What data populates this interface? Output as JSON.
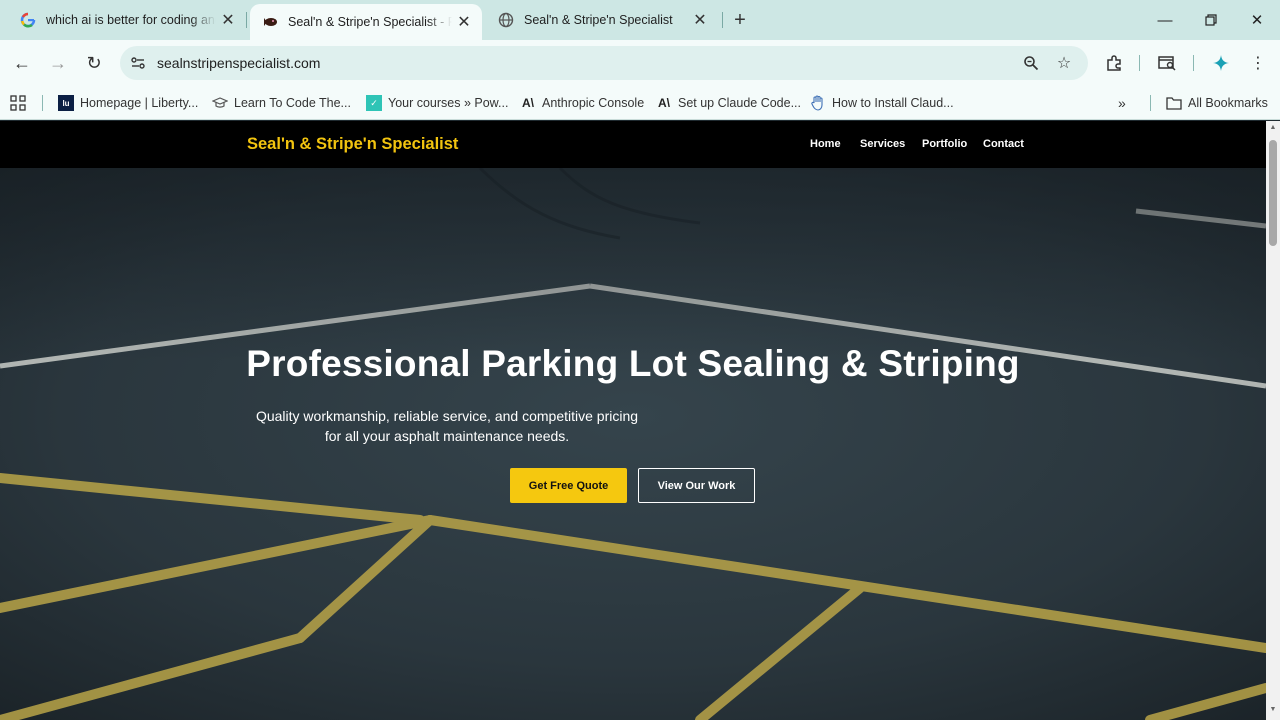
{
  "browser": {
    "tabs": [
      {
        "title": "which ai is better for coding and",
        "favicon": "google-g-icon"
      },
      {
        "title": "Seal'n & Stripe'n Specialist - Pro",
        "favicon": "site-favicon-icon"
      },
      {
        "title": "Seal'n & Stripe'n Specialist",
        "favicon": "globe-icon"
      }
    ],
    "url": "sealnstripenspecialist.com",
    "bookmarks": [
      {
        "label": "Homepage | Liberty...",
        "icon": "liberty-icon"
      },
      {
        "label": "Learn To Code The...",
        "icon": "graduation-cap-icon"
      },
      {
        "label": "Your courses » Pow...",
        "icon": "course-icon"
      },
      {
        "label": "Anthropic Console",
        "icon": "anthropic-icon"
      },
      {
        "label": "Set up Claude Code...",
        "icon": "anthropic-icon"
      },
      {
        "label": "How to Install Claud...",
        "icon": "hand-icon"
      }
    ],
    "all_bookmarks": "All Bookmarks"
  },
  "site": {
    "brand": "Seal'n & Stripe'n Specialist",
    "nav": [
      "Home",
      "Services",
      "Portfolio",
      "Contact"
    ],
    "hero": {
      "title": "Professional Parking Lot Sealing & Striping",
      "subtitle": "Quality workmanship, reliable service, and competitive pricing for all your asphalt maintenance needs.",
      "primary_cta": "Get Free Quote",
      "secondary_cta": "View Our Work"
    },
    "colors": {
      "accent": "#f5c80f",
      "nav_bg": "#000000",
      "asphalt": "#27333a"
    }
  }
}
